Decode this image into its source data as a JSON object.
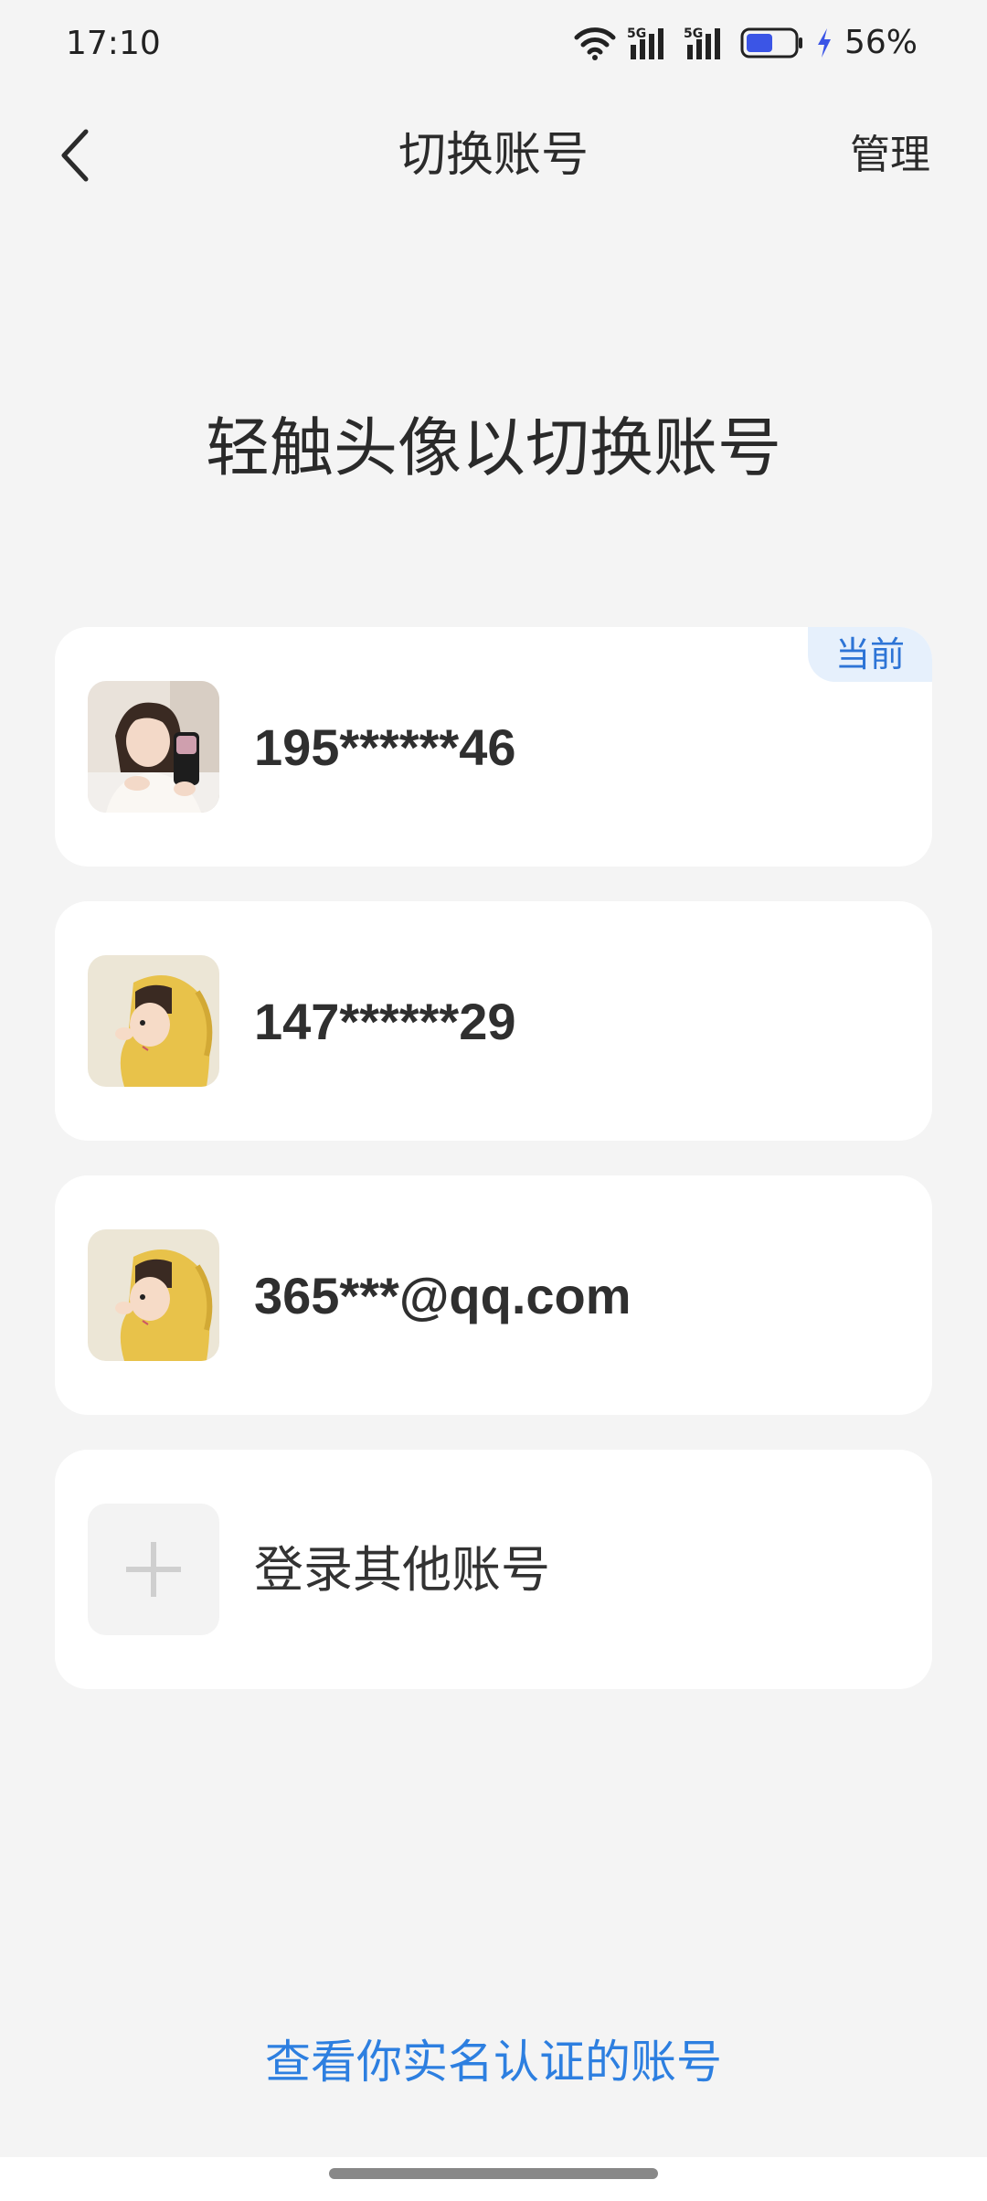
{
  "status_bar": {
    "time": "17:10",
    "battery_percent": "56%",
    "battery_level": 0.56,
    "icons": [
      "wifi-icon",
      "signal-5g-icon",
      "signal-5g-icon",
      "battery-icon",
      "charging-icon"
    ]
  },
  "header": {
    "back_icon": "chevron-left-icon",
    "title": "切换账号",
    "manage_label": "管理"
  },
  "hint": "轻触头像以切换账号",
  "accounts": [
    {
      "name": "195******46",
      "badge": "当前",
      "avatar": "girl-photo-avatar"
    },
    {
      "name": "147******29",
      "badge": "",
      "avatar": "yellow-hood-boy-avatar"
    },
    {
      "name": "365***@qq.com",
      "badge": "",
      "avatar": "yellow-hood-boy-avatar"
    }
  ],
  "add_account": {
    "label": "登录其他账号",
    "icon": "plus-icon"
  },
  "realname_link": "查看你实名认证的账号",
  "colors": {
    "background": "#f4f4f4",
    "card": "#ffffff",
    "accent": "#2d7fe0",
    "badge_bg": "#e6f0fc"
  }
}
